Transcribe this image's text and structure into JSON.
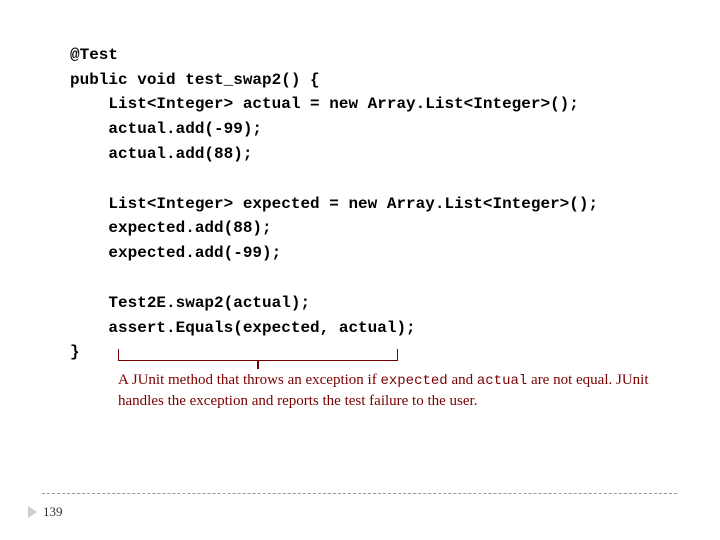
{
  "code": {
    "l1": "@Test",
    "l2": "public void test_swap2() {",
    "l3": "    List<Integer> actual = new Array.List<Integer>();",
    "l4": "    actual.add(-99);",
    "l5": "    actual.add(88);",
    "l6": "",
    "l7": "    List<Integer> expected = new Array.List<Integer>();",
    "l8": "    expected.add(88);",
    "l9": "    expected.add(-99);",
    "l10": "",
    "l11": "    Test2E.swap2(actual);",
    "l12": "    assert.Equals(expected, actual);",
    "l13": "}"
  },
  "annotation": {
    "part1": "A JUnit method that throws an exception if ",
    "mono1": "expected",
    "part2": " and ",
    "mono2": "actual",
    "part3": " are not equal. JUnit handles the exception and reports the test failure to the user."
  },
  "page_number": "139"
}
